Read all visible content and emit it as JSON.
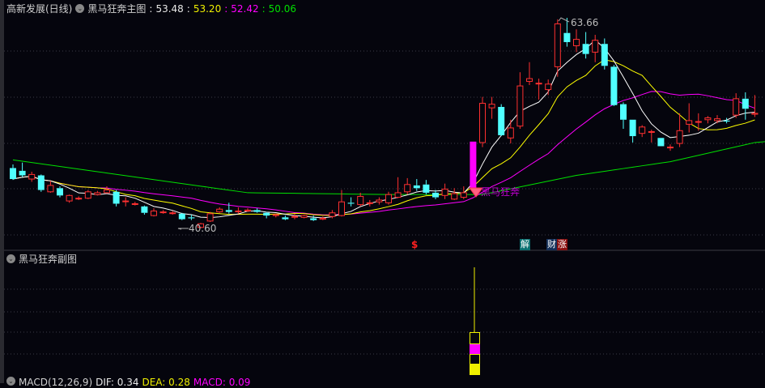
{
  "header": {
    "stock_name": "高新发展(日线)",
    "indicator": "黑马狂奔主图",
    "v1": "53.48",
    "v2": "53.20",
    "v3": "52.42",
    "v4": "50.06"
  },
  "sub_panel": {
    "title": "黑马狂奔副图"
  },
  "macd_panel": {
    "label": "MACD(12,26,9)",
    "dif": "DIF: 0.34",
    "dea": "DEA: 0.28",
    "macd": "MACD: 0.09"
  },
  "annotations": {
    "high": "63.66",
    "low": "40.60",
    "signal_text": "黑马狂奔",
    "s_mark": "$",
    "jie": "解",
    "cai": "财",
    "zhang": "涨"
  },
  "colors": {
    "up": "#ff3030",
    "down": "#50ffff",
    "ma5": "#ffffff",
    "ma10": "#ffff00",
    "ma20": "#ff00ff",
    "ma60": "#00e000",
    "limit": "#ff00ff"
  },
  "candles": [
    [
      47.2,
      46.0,
      47.6,
      45.9
    ],
    [
      46.9,
      46.4,
      47.8,
      46.2
    ],
    [
      46.0,
      46.5,
      46.8,
      45.7
    ],
    [
      46.4,
      44.8,
      46.5,
      44.6
    ],
    [
      44.6,
      45.3,
      45.8,
      44.5
    ],
    [
      45.0,
      44.2,
      45.2,
      44.0
    ],
    [
      43.6,
      44.2,
      44.3,
      43.4
    ],
    [
      43.9,
      43.9,
      44.1,
      43.7
    ],
    [
      43.9,
      44.6,
      44.8,
      43.8
    ],
    [
      44.3,
      44.5,
      44.7,
      44.2
    ],
    [
      44.5,
      44.8,
      45.2,
      44.4
    ],
    [
      44.6,
      43.3,
      44.8,
      43.0
    ],
    [
      43.6,
      43.6,
      44.0,
      43.0
    ],
    [
      43.3,
      43.3,
      43.5,
      43.1
    ],
    [
      43.0,
      42.3,
      43.1,
      42.1
    ],
    [
      42.0,
      42.5,
      42.8,
      41.9
    ],
    [
      42.4,
      42.4,
      42.6,
      42.2
    ],
    [
      42.3,
      42.3,
      42.5,
      42.1
    ],
    [
      42.2,
      41.6,
      42.3,
      41.5
    ],
    [
      41.8,
      41.7,
      42.1,
      41.5
    ],
    [
      40.7,
      41.1,
      41.2,
      40.6
    ],
    [
      41.4,
      42.2,
      42.4,
      41.3
    ],
    [
      42.4,
      42.7,
      42.9,
      42.3
    ],
    [
      42.6,
      42.4,
      43.4,
      42.2
    ],
    [
      42.5,
      42.5,
      42.9,
      42.2
    ],
    [
      42.5,
      42.6,
      42.8,
      42.4
    ],
    [
      42.6,
      42.4,
      42.8,
      42.3
    ],
    [
      42.3,
      42.0,
      42.4,
      41.7
    ],
    [
      42.0,
      42.1,
      42.2,
      41.8
    ],
    [
      41.8,
      41.6,
      42.0,
      41.5
    ],
    [
      41.9,
      41.9,
      42.2,
      41.6
    ],
    [
      41.8,
      42.0,
      42.1,
      41.7
    ],
    [
      41.7,
      41.5,
      42.0,
      41.4
    ],
    [
      41.6,
      41.7,
      41.9,
      41.5
    ],
    [
      41.9,
      42.3,
      42.6,
      41.7
    ],
    [
      42.0,
      43.5,
      44.8,
      41.9
    ],
    [
      43.4,
      43.3,
      44.0,
      43.0
    ],
    [
      43.2,
      44.1,
      44.5,
      43.0
    ],
    [
      43.4,
      43.4,
      43.7,
      43.0
    ],
    [
      43.5,
      43.7,
      44.0,
      43.2
    ],
    [
      43.4,
      44.3,
      44.6,
      43.2
    ],
    [
      44.0,
      44.5,
      46.2,
      43.9
    ],
    [
      44.6,
      45.4,
      46.1,
      44.3
    ],
    [
      45.3,
      45.0,
      46.0,
      44.7
    ],
    [
      45.4,
      44.5,
      45.9,
      44.3
    ],
    [
      44.5,
      44.0,
      44.8,
      43.8
    ],
    [
      44.2,
      44.9,
      45.5,
      43.8
    ],
    [
      43.8,
      44.4,
      45.0,
      43.7
    ],
    [
      44.0,
      44.5,
      45.2,
      43.8
    ],
    [
      45.0,
      50.1,
      50.1,
      45.0
    ],
    [
      50.0,
      54.3,
      55.0,
      49.5
    ],
    [
      53.8,
      54.2,
      55.0,
      52.6
    ],
    [
      53.9,
      50.8,
      54.2,
      50.7
    ],
    [
      50.5,
      51.6,
      52.5,
      49.9
    ],
    [
      51.8,
      56.2,
      57.7,
      51.5
    ],
    [
      56.7,
      57.0,
      58.8,
      56.3
    ],
    [
      56.5,
      56.5,
      57.0,
      54.7
    ],
    [
      55.8,
      56.4,
      56.9,
      55.2
    ],
    [
      58.3,
      63.0,
      63.5,
      57.2
    ],
    [
      62.0,
      61.0,
      63.66,
      60.5
    ],
    [
      60.6,
      61.3,
      62.4,
      59.9
    ],
    [
      60.8,
      59.7,
      62.1,
      59.2
    ],
    [
      59.9,
      61.2,
      61.8,
      58.8
    ],
    [
      60.8,
      58.4,
      61.4,
      58.0
    ],
    [
      58.3,
      54.1,
      58.5,
      54.0
    ],
    [
      54.2,
      52.5,
      54.4,
      51.5
    ],
    [
      52.5,
      50.7,
      52.5,
      50.0
    ],
    [
      51.0,
      51.7,
      51.9,
      50.6
    ],
    [
      51.2,
      51.2,
      51.4,
      50.0
    ],
    [
      50.5,
      49.6,
      50.5,
      49.6
    ],
    [
      49.5,
      49.5,
      49.8,
      49.1
    ],
    [
      49.9,
      51.3,
      53.2,
      49.5
    ],
    [
      52.0,
      52.4,
      54.3,
      51.1
    ],
    [
      52.3,
      52.3,
      53.2,
      51.3
    ],
    [
      52.5,
      52.7,
      52.9,
      52.1
    ],
    [
      52.4,
      52.6,
      53.0,
      52.1
    ],
    [
      52.4,
      52.3,
      52.7,
      52.1
    ],
    [
      53.0,
      54.8,
      55.4,
      52.7
    ],
    [
      54.8,
      53.7,
      55.5,
      52.5
    ],
    [
      53.1,
      53.2,
      55.2,
      52.8
    ]
  ],
  "limit_up_index": 49,
  "ma60": [
    [
      0,
      48.1
    ],
    [
      17,
      45.65
    ],
    [
      25,
      44.5
    ],
    [
      40,
      44.3
    ],
    [
      50,
      44.3
    ],
    [
      60,
      46.4
    ],
    [
      70,
      47.9
    ],
    [
      79,
      50.0
    ]
  ]
}
